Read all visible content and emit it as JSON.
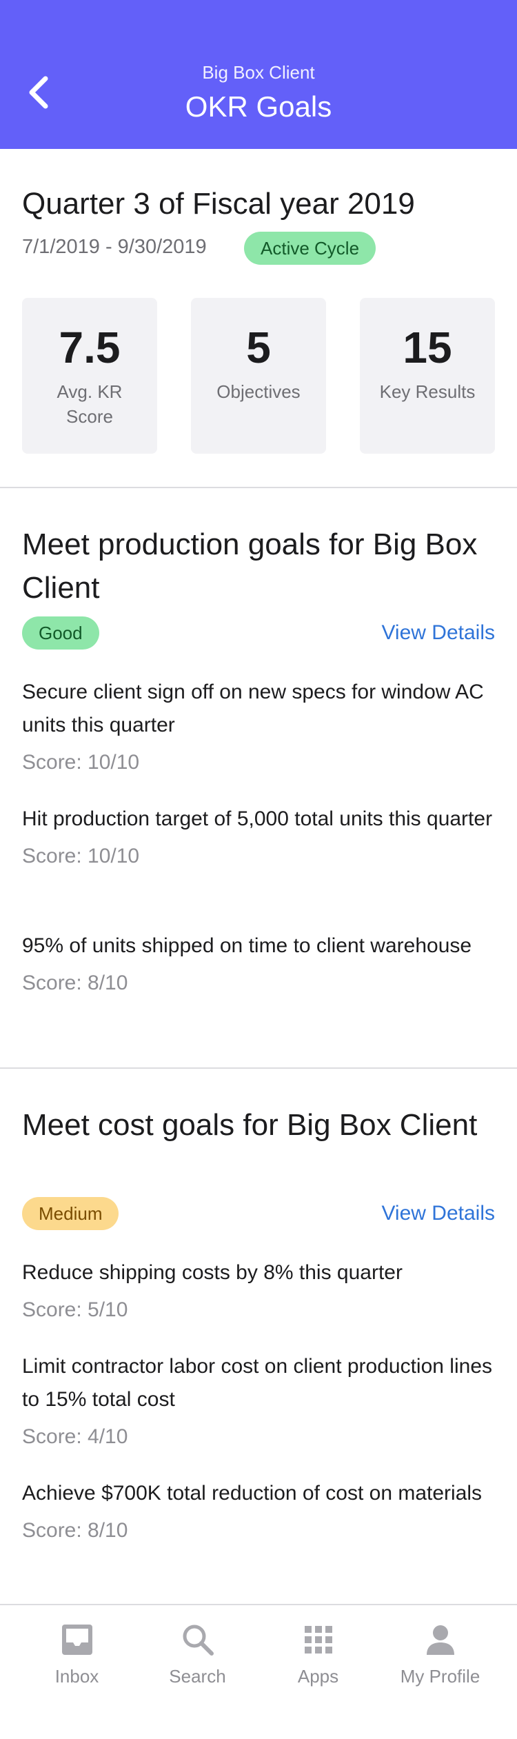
{
  "header": {
    "subtitle": "Big Box Client",
    "title": "OKR Goals",
    "background_color": "#6360f9"
  },
  "cycle": {
    "title": "Quarter 3 of Fiscal year 2019",
    "dates": "7/1/2019 - 9/30/2019",
    "status": "Active Cycle",
    "stats": [
      {
        "value": "7.5",
        "label": "Avg. KR Score"
      },
      {
        "value": "5",
        "label": "Objectives"
      },
      {
        "value": "15",
        "label": "Key Results"
      }
    ]
  },
  "objectives": [
    {
      "title": "Meet production goals for Big Box Client",
      "status": "Good",
      "status_color": "#8ee6a9",
      "link": "View Details",
      "key_results": [
        {
          "text": "Secure client sign off on new specs for window AC units this quarter",
          "score": "Score: 10/10"
        },
        {
          "text": "Hit production target of 5,000 total units this quarter",
          "score": "Score: 10/10"
        },
        {
          "text": "95% of units shipped on time to client warehouse",
          "score": "Score: 8/10"
        }
      ]
    },
    {
      "title": "Meet cost goals for Big Box Client",
      "status": "Medium",
      "status_color": "#fcd98d",
      "link": "View Details",
      "key_results": [
        {
          "text": "Reduce shipping costs by 8% this quarter",
          "score": "Score: 5/10"
        },
        {
          "text": "Limit contractor labor cost on client production lines to 15% total cost",
          "score": "Score: 4/10"
        },
        {
          "text": "Achieve $700K total reduction of cost on materials",
          "score": "Score: 8/10"
        }
      ]
    }
  ],
  "tabbar": {
    "items": [
      {
        "label": "Inbox",
        "icon": "inbox-icon"
      },
      {
        "label": "Search",
        "icon": "search-icon"
      },
      {
        "label": "Apps",
        "icon": "apps-grid-icon"
      },
      {
        "label": "My Profile",
        "icon": "profile-icon"
      }
    ]
  },
  "colors": {
    "accent": "#6360f9",
    "link": "#2f74d8",
    "good_badge": "#8ee6a9",
    "medium_badge": "#fcd98d"
  }
}
